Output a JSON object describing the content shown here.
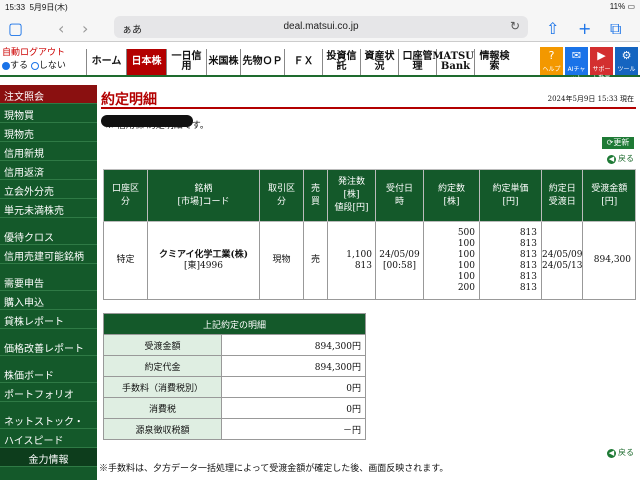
{
  "status_bar": {
    "time": "15:33",
    "date": "5月9日(木)",
    "battery": "11%"
  },
  "browser": {
    "aa": "ぁあ",
    "url": "deal.matsui.co.jp",
    "reload_icon": "reload-icon"
  },
  "logout": {
    "label": "自動ログアウト",
    "on": "する",
    "off": "しない"
  },
  "tabs": [
    "ホーム",
    "日本株",
    "一日信用",
    "米国株",
    "先物ＯＰ",
    "ＦＸ",
    "投資信託",
    "資産状況",
    "口座管理",
    "MATSUI Bank",
    "情報検索"
  ],
  "icon_buttons": [
    "ヘルプ",
    "AIチャット",
    "サポート動画",
    "ツール"
  ],
  "sidebar": {
    "header": "注文照会",
    "items1": [
      "現物買",
      "現物売",
      "信用新規",
      "信用返済",
      "立会外分売",
      "単元未満株売"
    ],
    "items2": [
      "優待クロス",
      "信用売建可能銘柄"
    ],
    "items3": [
      "需要申告",
      "購入申込",
      "貸株レポート"
    ],
    "items4": [
      "価格改善レポート"
    ],
    "items5": [
      "株価ボード",
      "ポートフォリオ"
    ],
    "items6": [
      "ネットストック・",
      "ハイスピード"
    ],
    "bottom": "金力情報"
  },
  "page": {
    "title": "約定明細",
    "datetime": "2024年5月9日 15:33 現在",
    "note": "※ 信用株 約定明細です。",
    "update": "更新",
    "back": "戻る"
  },
  "order_table": {
    "headers": [
      "口座区分",
      "銘柄[市場]コード",
      "取引区分",
      "売買",
      "発注数[株]値段[円]",
      "受付日時",
      "約定数[株]",
      "約定単価[円]",
      "約定日受渡日",
      "受渡金額[円]"
    ],
    "row": {
      "account": "特定",
      "name": "クミアイ化学工業(株)",
      "code": "[東]4996",
      "trade_type": "現物",
      "side": "売",
      "order_qty": "1,100",
      "order_price": "813",
      "recv_date": "24/05/09",
      "recv_time": "[00:58]",
      "exec_qty": [
        "500",
        "100",
        "100",
        "100",
        "100",
        "200"
      ],
      "exec_price": [
        "813",
        "813",
        "813",
        "813",
        "813",
        "813"
      ],
      "exec_date": "24/05/09",
      "settle_date": "24/05/13",
      "amount": "894,300"
    }
  },
  "summary": {
    "title": "上記約定の明細",
    "rows": [
      {
        "label": "受渡金額",
        "value": "894,300円"
      },
      {
        "label": "約定代金",
        "value": "894,300円"
      },
      {
        "label": "手数料（消費税別）",
        "value": "0円"
      },
      {
        "label": "消費税",
        "value": "0円"
      },
      {
        "label": "源泉徴収税額",
        "value": "－円"
      }
    ]
  },
  "footnote": "※手数料は、夕方データ一括処理によって受渡金額が確定した後、画面反映されます。"
}
